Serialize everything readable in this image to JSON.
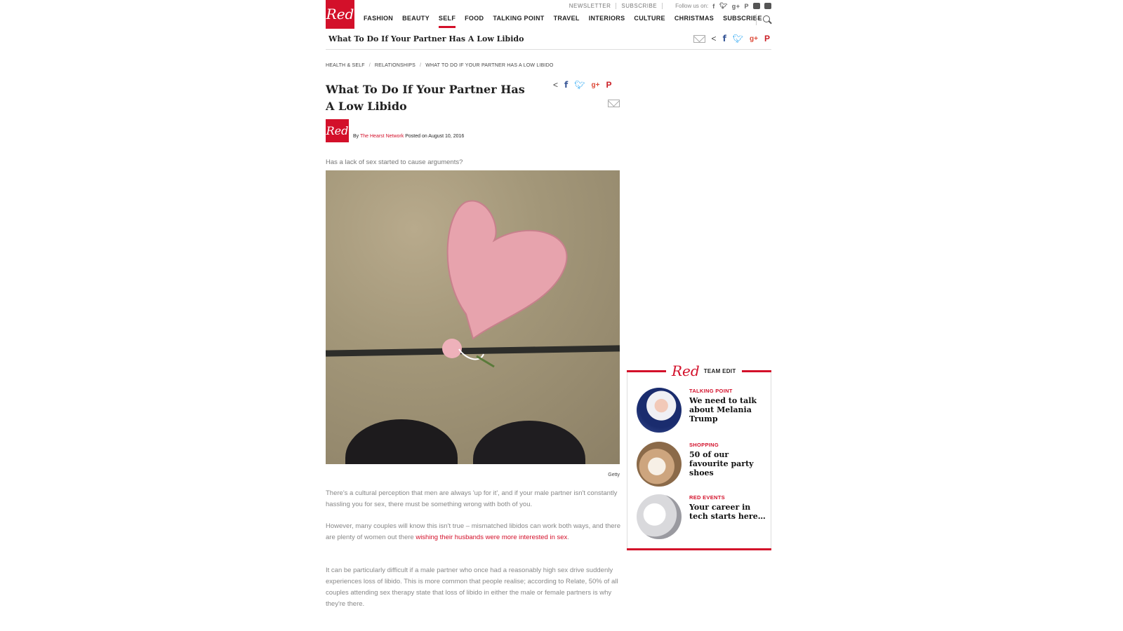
{
  "header": {
    "logo": "Red",
    "top_links": [
      "NEWSLETTER",
      "SUBSCRIBE"
    ],
    "follow_label": "Follow us on:",
    "nav": [
      "FASHION",
      "BEAUTY",
      "SELF",
      "FOOD",
      "TALKING POINT",
      "TRAVEL",
      "INTERIORS",
      "CULTURE",
      "CHRISTMAS",
      "SUBSCRIBE"
    ],
    "active_nav": "SELF",
    "social_icons": [
      "facebook-icon",
      "twitter-icon",
      "google-plus-icon",
      "pinterest-icon",
      "instagram-icon",
      "youtube-icon"
    ]
  },
  "sticky_bar": {
    "title": "What To Do If Your Partner Has A Low Libido"
  },
  "breadcrumb": [
    "HEALTH & SELF",
    "RELATIONSHIPS",
    "WHAT TO DO IF YOUR PARTNER HAS A LOW LIBIDO"
  ],
  "breadcrumb_sep": "/",
  "article": {
    "title": "What To Do If Your Partner Has A Low Libido",
    "byline_by": "By",
    "author": "The Hearst Network",
    "posted": "Posted on August 10, 2016",
    "standfirst": "Has a lack of sex started to cause arguments?",
    "image_caption": "Getty",
    "p1": "There's a cultural perception that men are always 'up for it', and if your male partner isn't constantly hassling you for sex, there must be something wrong with both of you.",
    "p2_a": "However, many couples will know this isn't true – mismatched libidos can work both ways, and there are plenty of women out there ",
    "p2_link": "wishing their husbands were more interested in sex",
    "p2_b": ".",
    "p3": "It can be particularly difficult if a male partner who once had a reasonably high sex drive suddenly experiences loss of libido. This is more common that people realise; according to Relate, 50% of all couples attending sex therapy state that loss of libido in either the male or female partners is why they're there."
  },
  "share": {
    "fb": "f",
    "gp": "g+",
    "pi": "P"
  },
  "sidebar": {
    "logo": "Red",
    "label": "TEAM EDIT",
    "items": [
      {
        "category": "TALKING POINT",
        "title": "We need to talk about Melania Trump"
      },
      {
        "category": "SHOPPING",
        "title": "50 of our favourite party shoes"
      },
      {
        "category": "RED EVENTS",
        "title": "Your career in tech starts here…"
      }
    ]
  },
  "colors": {
    "brand": "#d3102a"
  }
}
